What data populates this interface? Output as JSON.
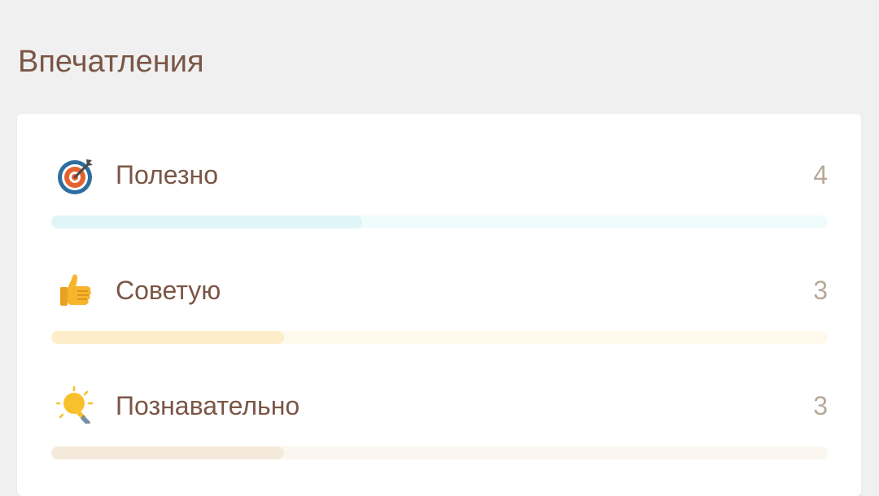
{
  "section": {
    "title": "Впечатления"
  },
  "impressions": {
    "max_count": 10,
    "items": [
      {
        "label": "Полезно",
        "count": "4",
        "icon": "target-icon",
        "fill_fraction": 0.4,
        "track_color": "#f0fbfc",
        "fill_color": "#dff5f8"
      },
      {
        "label": "Советую",
        "count": "3",
        "icon": "thumbs-up-icon",
        "fill_fraction": 0.3,
        "track_color": "#fffaec",
        "fill_color": "#fdedc8"
      },
      {
        "label": "Познавательно",
        "count": "3",
        "icon": "lightbulb-icon",
        "fill_fraction": 0.3,
        "track_color": "#fbf7f0",
        "fill_color": "#f3eadb"
      }
    ]
  }
}
